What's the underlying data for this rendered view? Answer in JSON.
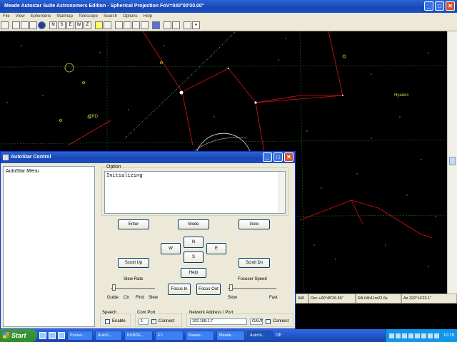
{
  "main_window": {
    "title": "Meade Autostar Suite Astronomers Edition - Spherical Projection   FoV=040°00'00.00\"",
    "controls": {
      "minimize": "_",
      "maximize": "□",
      "close": "✕"
    }
  },
  "menubar": [
    "File",
    "View",
    "Ephemeris",
    "Starmap",
    "Telescope",
    "Search",
    "Options",
    "Help"
  ],
  "toolbar": [
    "",
    "",
    "",
    "",
    "",
    "N",
    "S",
    "E",
    "W",
    "Z",
    "",
    "",
    "",
    "",
    "",
    "",
    "",
    "",
    "",
    ""
  ],
  "sky_labels": {
    "object_left": "CRD",
    "object_right": "Hyades"
  },
  "status_bar": {
    "field1": "040",
    "dec": "Dec +00°45'26.55\"",
    "ra": "RA 04h11m22.6s",
    "az": "Az 222°14'22.1\""
  },
  "autostar": {
    "title": "AutoStar Control",
    "controls": {
      "minimize": "_",
      "maximize": "□",
      "close": "✕"
    },
    "menu_label": "AutoStar Menu",
    "option_label": "Option",
    "option_text": "Initializing",
    "buttons": {
      "enter": "Enter",
      "mode": "Mode",
      "goto": "Goto",
      "north": "N",
      "west": "W",
      "east": "E",
      "south": "S",
      "scroll_up": "Scroll Up",
      "scroll_dn": "Scroll Dn",
      "help": "Help",
      "focus_in": "Focus In",
      "focus_out": "Focus Out"
    },
    "slew_rate": {
      "label": "Slew Rate",
      "ticks": [
        "Guide",
        "Ctr",
        "Find",
        "Slew"
      ]
    },
    "focuser_speed": {
      "label": "Focuser Speed",
      "min": "Slow",
      "max": "Fast"
    },
    "speech": {
      "legend": "Speech",
      "enable_label": "Enable",
      "enabled": false
    },
    "com_port": {
      "legend": "Com Port",
      "value": "1",
      "connect_label": "Connect",
      "connected": true
    },
    "network": {
      "legend": "Network Address / Port",
      "address": "192.168.1.7",
      "port": "GAUT",
      "connect_label": "Connect",
      "connected": false
    }
  },
  "taskbar": {
    "start": "Start",
    "tasks": [
      "Pocket...",
      "AutoS...",
      "BUNDE...",
      "E:\\",
      "Meade...",
      "Meade...",
      "AutoSt..."
    ],
    "language": "DE",
    "clock": "10:15"
  }
}
